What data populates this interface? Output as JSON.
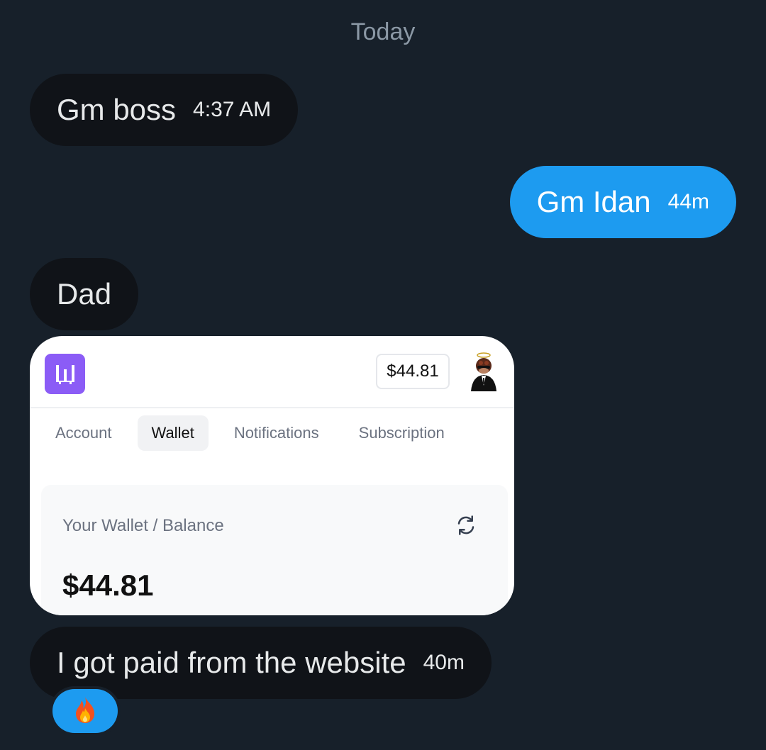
{
  "conversation": {
    "date_separator": "Today",
    "messages": [
      {
        "direction": "incoming",
        "text": "Gm boss",
        "time": "4:37 AM"
      },
      {
        "direction": "outgoing",
        "text": "Gm Idan",
        "time": "44m"
      },
      {
        "direction": "incoming",
        "text": "Dad",
        "time": ""
      },
      {
        "direction": "incoming",
        "text": "I got paid from the website",
        "time": "40m"
      }
    ],
    "reaction": {
      "emoji_icon": "fire-icon",
      "color": "#1d9bf0"
    }
  },
  "attachment": {
    "logo_icon": "w-logo-icon",
    "header_balance": "$44.81",
    "avatar_icon": "avatar-icon",
    "tabs": [
      "Account",
      "Wallet",
      "Notifications",
      "Subscription"
    ],
    "active_tab": "Wallet",
    "wallet_title": "Your Wallet / Balance",
    "wallet_amount": "$44.81",
    "refresh_icon": "refresh-icon"
  },
  "colors": {
    "background": "#17202a",
    "incoming_bubble": "#101318",
    "outgoing_bubble": "#1d9bf0",
    "brand_purple": "#8b5cf6"
  }
}
